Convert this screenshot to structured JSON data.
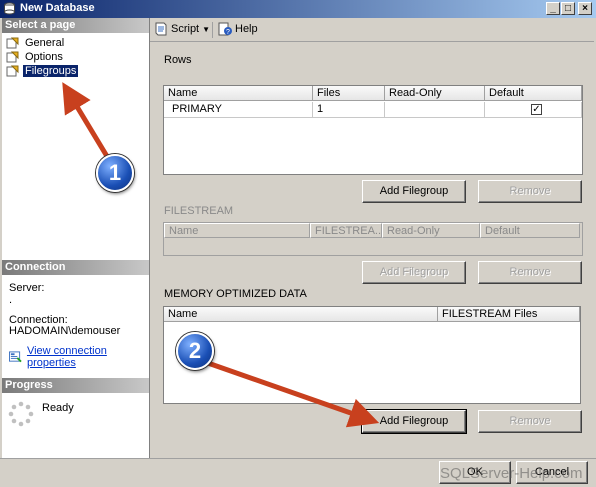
{
  "window": {
    "title": "New Database"
  },
  "left": {
    "select_header": "Select a page",
    "pages": [
      "General",
      "Options",
      "Filegroups"
    ],
    "connection_header": "Connection",
    "server_label": "Server:",
    "server_value": ".",
    "connection_label": "Connection:",
    "connection_value": "HADOMAIN\\demouser",
    "view_link": "View connection properties",
    "progress_header": "Progress",
    "progress_status": "Ready"
  },
  "toolbar": {
    "script": "Script",
    "help": "Help"
  },
  "rows": {
    "label": "Rows",
    "columns": [
      "Name",
      "Files",
      "Read-Only",
      "Default"
    ],
    "data": [
      [
        "PRIMARY",
        "1",
        "",
        "checked"
      ]
    ],
    "add_button": "Add Filegroup",
    "remove_button": "Remove"
  },
  "filestream": {
    "label": "FILESTREAM",
    "columns": [
      "Name",
      "FILESTREA...",
      "Read-Only",
      "Default"
    ],
    "add_button": "Add Filegroup",
    "remove_button": "Remove"
  },
  "memory": {
    "label": "MEMORY OPTIMIZED DATA",
    "columns": [
      "Name",
      "FILESTREAM Files"
    ],
    "add_button": "Add Filegroup",
    "remove_button": "Remove"
  },
  "footer": {
    "ok": "OK",
    "cancel": "Cancel",
    "watermark": "SQLServer-Help.com"
  },
  "annotations": {
    "marker1": "1",
    "marker2": "2"
  },
  "colors": {
    "title_start": "#0a246a",
    "title_end": "#a6caf0",
    "arrow": "#c8401e",
    "selection": "#0a246a"
  }
}
